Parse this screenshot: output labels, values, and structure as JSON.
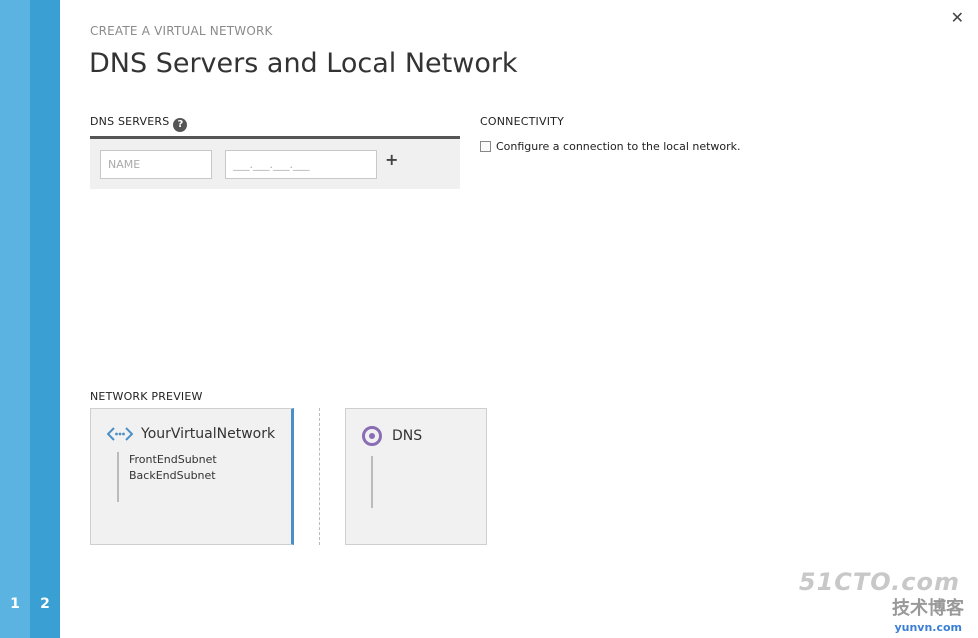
{
  "wizard": {
    "steps": [
      "1",
      "2"
    ],
    "breadcrumb": "CREATE A VIRTUAL NETWORK",
    "title": "DNS Servers and Local Network",
    "close_glyph": "✕"
  },
  "dns_servers": {
    "label": "DNS SERVERS",
    "help_glyph": "?",
    "name_placeholder": "NAME",
    "ip_placeholder": "___.___.___.___",
    "add_glyph": "+"
  },
  "connectivity": {
    "label": "CONNECTIVITY",
    "checkbox_label": "Configure a connection to the local network.",
    "checked": false
  },
  "network_preview": {
    "label": "NETWORK PREVIEW",
    "vnet_name": "YourVirtualNetwork",
    "subnets": [
      "FrontEndSubnet",
      "BackEndSubnet"
    ],
    "dns_label": "DNS",
    "colors": {
      "accent": "#4a8fc6",
      "dns_ring": "#8a6db5"
    }
  },
  "watermark": {
    "line1": "51CTO.com",
    "line2": "技术博客",
    "line3": "yunvn.com"
  },
  "icons": {
    "vnet": "virtual-network-icon",
    "dns": "dns-ring-icon",
    "help": "help-icon",
    "close": "close-icon",
    "add": "plus-icon"
  },
  "colors": {
    "rail_light": "#5ab3e0",
    "rail_dark": "#3a9fd2"
  }
}
